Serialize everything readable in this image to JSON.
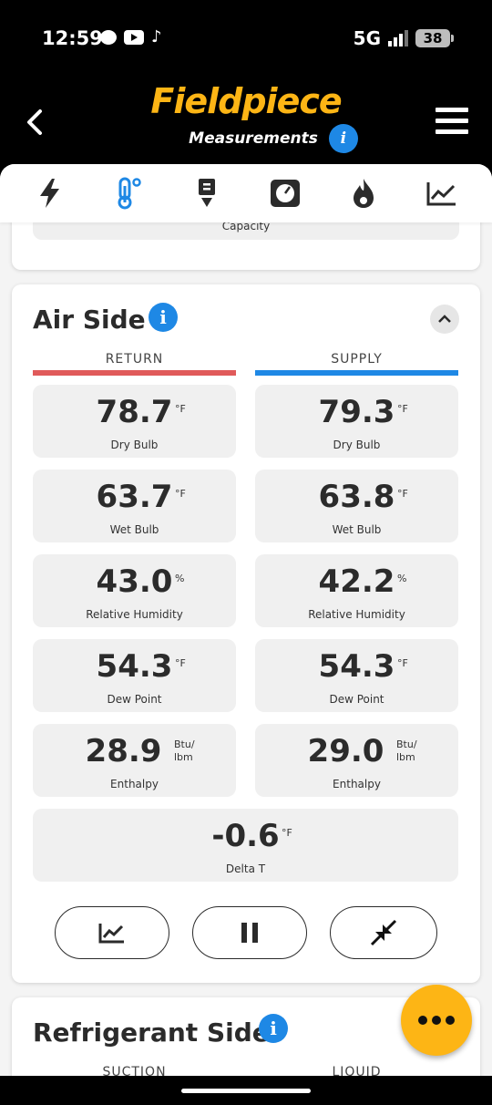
{
  "status_bar": {
    "time": "12:59",
    "network": "5G",
    "battery": "38",
    "app_icons": [
      "message-icon",
      "youtube-icon",
      "tiktok-icon"
    ]
  },
  "header": {
    "logo": "Fieldpiece",
    "subtitle": "Measurements",
    "info": "i"
  },
  "tabs": [
    {
      "icon": "bolt-icon",
      "active": false
    },
    {
      "icon": "thermometer-icon",
      "active": true
    },
    {
      "icon": "download-icon",
      "active": false
    },
    {
      "icon": "gauge-icon",
      "active": false
    },
    {
      "icon": "flame-icon",
      "active": false
    },
    {
      "icon": "trend-chart-icon",
      "active": false
    }
  ],
  "capacity": {
    "label": "Capacity"
  },
  "air_side": {
    "title": "Air Side",
    "return_label": "RETURN",
    "supply_label": "SUPPLY",
    "return_color": "#e05a5a",
    "supply_color": "#1e88e5",
    "return": [
      {
        "value": "78.7",
        "unit": "°F",
        "label": "Dry Bulb"
      },
      {
        "value": "63.7",
        "unit": "°F",
        "label": "Wet Bulb"
      },
      {
        "value": "43.0",
        "unit": "%",
        "label": "Relative Humidity"
      },
      {
        "value": "54.3",
        "unit": "°F",
        "label": "Dew Point"
      },
      {
        "value": "28.9",
        "unit": "Btu/\nlbm",
        "label": "Enthalpy"
      }
    ],
    "supply": [
      {
        "value": "79.3",
        "unit": "°F",
        "label": "Dry Bulb"
      },
      {
        "value": "63.8",
        "unit": "°F",
        "label": "Wet Bulb"
      },
      {
        "value": "42.2",
        "unit": "%",
        "label": "Relative Humidity"
      },
      {
        "value": "54.3",
        "unit": "°F",
        "label": "Dew Point"
      },
      {
        "value": "29.0",
        "unit": "Btu/\nlbm",
        "label": "Enthalpy"
      }
    ],
    "delta_t": {
      "value": "-0.6",
      "unit": "°F",
      "label": "Delta T"
    },
    "controls": [
      "trend-chart-icon",
      "pause-icon",
      "collapse-arrows-icon"
    ]
  },
  "refrigerant_side": {
    "title": "Refrigerant Side",
    "suction_label": "SUCTION",
    "liquid_label": "LIQUID"
  },
  "colors": {
    "brand_yellow": "#fdb515",
    "info_blue": "#1e88e5"
  }
}
